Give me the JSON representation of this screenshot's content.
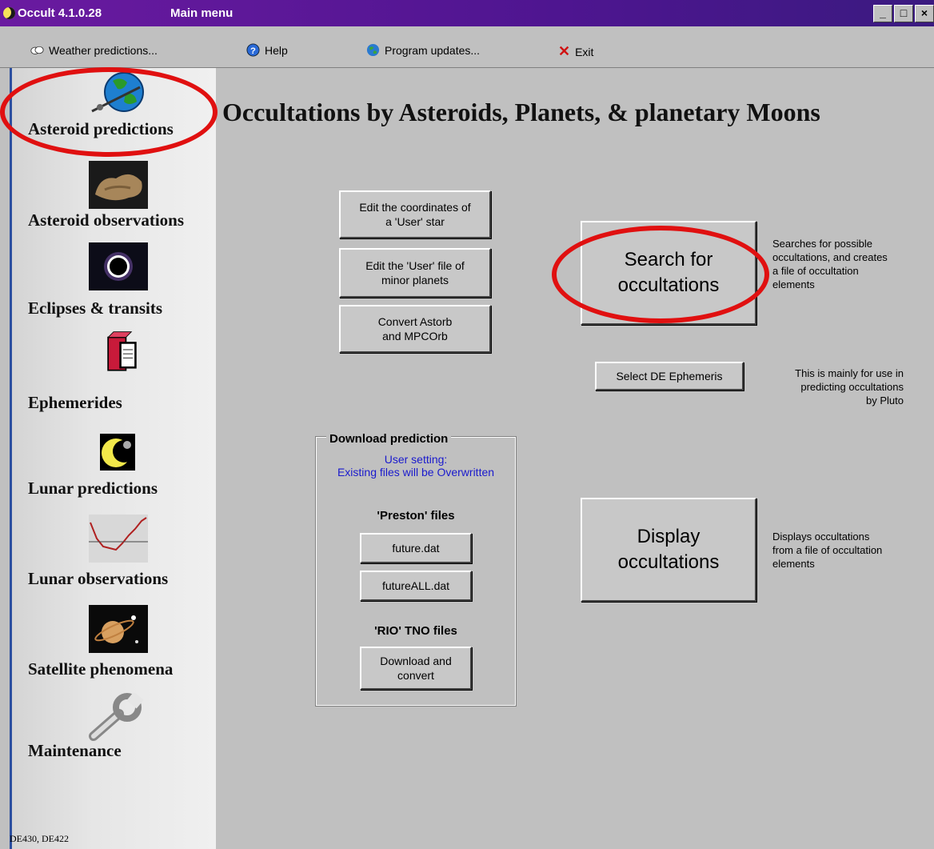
{
  "window": {
    "app_name": "Occult 4.1.0.28",
    "title": "Main menu"
  },
  "menubar": {
    "weather": "Weather predictions...",
    "help": "Help",
    "updates": "Program updates...",
    "exit": "Exit"
  },
  "sidebar": {
    "items": [
      {
        "label": "Asteroid predictions",
        "icon": "asteroid-earth-icon"
      },
      {
        "label": "Asteroid observations",
        "icon": "asteroid-rock-icon"
      },
      {
        "label": "Eclipses & transits",
        "icon": "eclipse-icon"
      },
      {
        "label": "Ephemerides",
        "icon": "book-icon"
      },
      {
        "label": "Lunar predictions",
        "icon": "moon-icon"
      },
      {
        "label": "Lunar observations",
        "icon": "lightcurve-icon"
      },
      {
        "label": "Satellite phenomena",
        "icon": "saturn-icon"
      },
      {
        "label": "Maintenance",
        "icon": "wrench-icon"
      }
    ],
    "status": "DE430, DE422"
  },
  "main": {
    "heading": "Occultations by Asteroids, Planets, & planetary Moons",
    "edit_user_star": [
      "Edit the coordinates of",
      "a 'User' star"
    ],
    "edit_user_file": [
      "Edit the 'User' file of",
      "minor planets"
    ],
    "convert": [
      "Convert Astorb",
      "and MPCOrb"
    ],
    "search": [
      "Search for",
      "occultations"
    ],
    "search_note": [
      "Searches for possible",
      "occultations, and creates",
      "a file of occultation",
      "elements"
    ],
    "select_de": "Select DE Ephemeris",
    "select_de_note": [
      "This is mainly for use in",
      "predicting occultations",
      "by Pluto"
    ],
    "display": [
      "Display",
      "occultations"
    ],
    "display_note": [
      "Displays occultations",
      "from a file of occultation",
      "elements"
    ]
  },
  "download": {
    "title": "Download prediction",
    "user_setting": "User setting:",
    "overwrite": "Existing files will be Overwritten",
    "preston_head": "'Preston' files",
    "future": "future.dat",
    "futureall": "futureALL.dat",
    "rio_head": "'RIO' TNO files",
    "download_convert": [
      "Download and",
      "convert"
    ]
  },
  "colors": {
    "highlight_ring": "#e01010",
    "title_bar": "#5a1890",
    "note_blue": "#1a1acd"
  }
}
